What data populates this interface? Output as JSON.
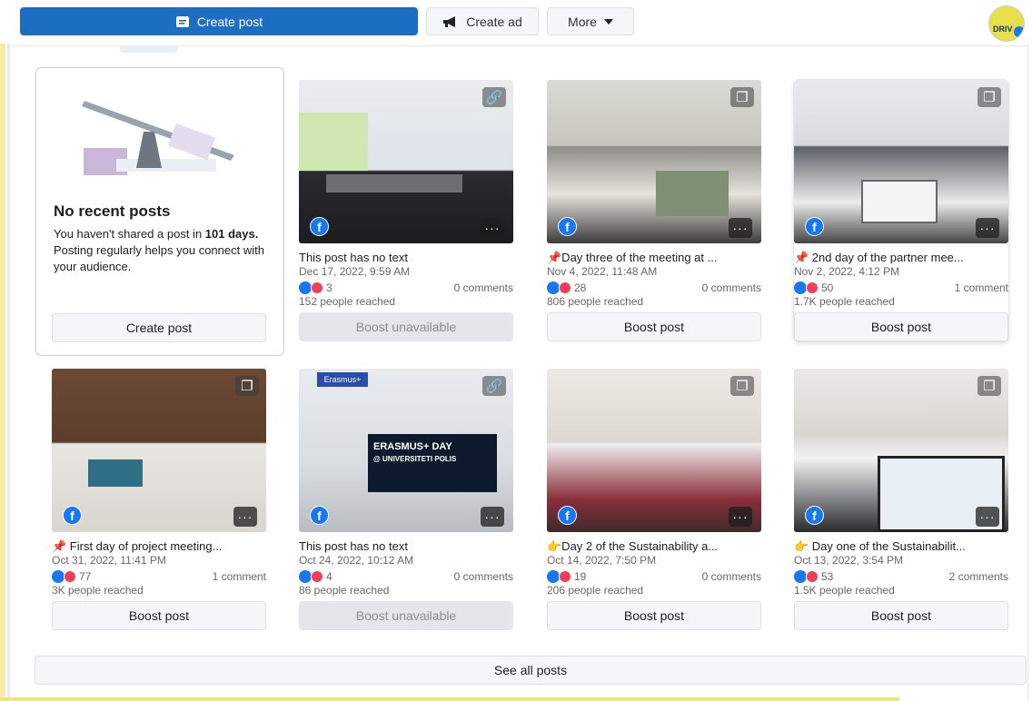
{
  "toolbar": {
    "create_post_label": "Create post",
    "create_ad_label": "Create ad",
    "more_label": "More",
    "avatar_text": "DRIV"
  },
  "empty_state": {
    "title": "No recent posts",
    "text_pre": "You haven't shared a post in ",
    "text_days": "101 days.",
    "text_post": " Posting regularly helps you connect with your audience.",
    "button_label": "Create post"
  },
  "posts": [
    {
      "title": "This post has no text",
      "date": "Dec 17, 2022, 9:59 AM",
      "reactions": "3",
      "comments": "0 comments",
      "reached": "152 people reached",
      "button": "Boost unavailable",
      "badge": "link-icon"
    },
    {
      "title": "📌Day three of the meeting at ...",
      "date": "Nov 4, 2022, 11:48 AM",
      "reactions": "28",
      "comments": "0 comments",
      "reached": "806 people reached",
      "button": "Boost post",
      "badge": "album-icon"
    },
    {
      "title": "📌 2nd day of the partner mee...",
      "date": "Nov 2, 2022, 4:12 PM",
      "reactions": "50",
      "comments": "1 comment",
      "reached": "1.7K people reached",
      "button": "Boost post",
      "badge": "album-icon"
    },
    {
      "title": "📌 First day of project meeting...",
      "date": "Oct 31, 2022, 11:41 PM",
      "reactions": "77",
      "comments": "1 comment",
      "reached": "3K people reached",
      "button": "Boost post",
      "badge": "album-icon"
    },
    {
      "title": "This post has no text",
      "date": "Oct 24, 2022, 10:12 AM",
      "reactions": "4",
      "comments": "0 comments",
      "reached": "86 people reached",
      "button": "Boost unavailable",
      "badge": "link-icon",
      "image_text": "Erasmus+ · ERASMUS+ DAY · ERASMUS+ DAY @ UNIVERSITETI POLIS"
    },
    {
      "title": "👉Day 2 of the Sustainability a...",
      "date": "Oct 14, 2022, 7:50 PM",
      "reactions": "19",
      "comments": "0 comments",
      "reached": "206 people reached",
      "button": "Boost post",
      "badge": "album-icon"
    },
    {
      "title": "👉 Day one of the Sustainabilit...",
      "date": "Oct 13, 2022, 3:54 PM",
      "reactions": "53",
      "comments": "2 comments",
      "reached": "1.5K people reached",
      "button": "Boost post",
      "badge": "album-icon"
    }
  ],
  "see_all_label": "See all posts",
  "colors": {
    "primary": "#1b6ec2",
    "facebook_blue": "#1877f2",
    "love_red": "#f33e58",
    "muted_text": "#65676b",
    "disabled_bg": "#e4e6eb"
  }
}
